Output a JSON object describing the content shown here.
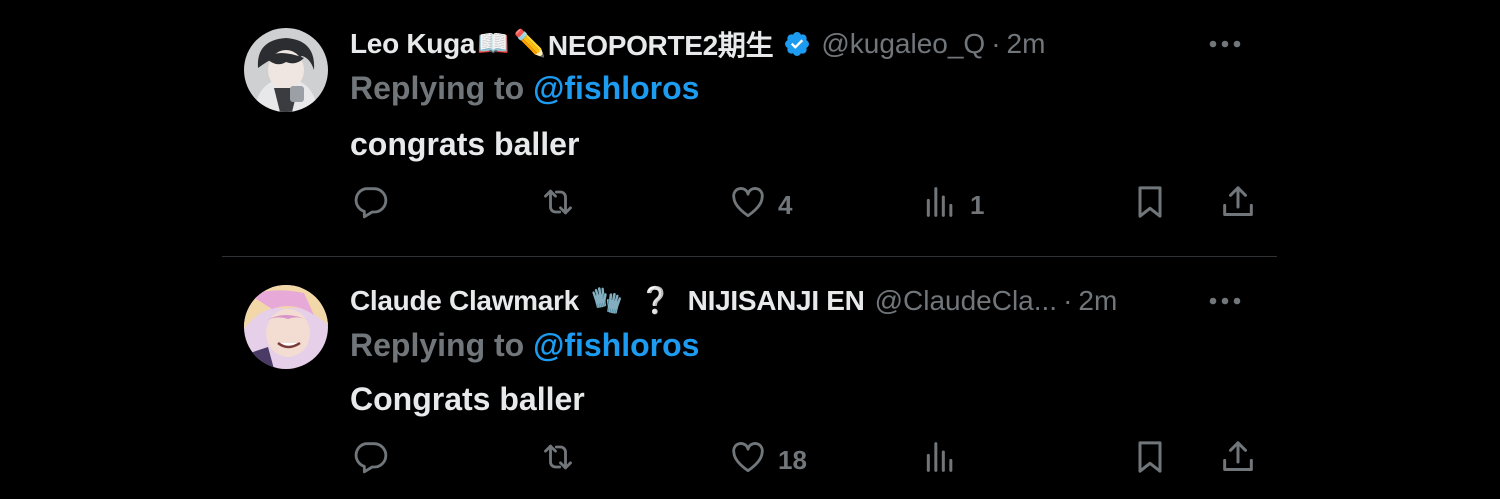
{
  "posts": [
    {
      "name_main": "Leo Kuga",
      "name_emoji_1": "📖",
      "name_emoji_2": "✏️",
      "name_suffix": "NEOPORTE2期生",
      "handle": "@kugaleo_Q",
      "dot": "·",
      "time": "2m",
      "replying_prefix": "Replying to",
      "replying_handle": "@fishloros",
      "text": "congrats baller",
      "likes": "4",
      "views": "1",
      "verified": true
    },
    {
      "name_main": "Claude Clawmark",
      "name_emoji_1": "🧤",
      "name_emoji_2": "❔",
      "name_suffix": "NIJISANJI EN",
      "handle": "@ClaudeCla...",
      "dot": "·",
      "time": "2m",
      "replying_prefix": "Replying to",
      "replying_handle": "@fishloros",
      "text": "Congrats baller",
      "likes": "18",
      "views": ""
    }
  ],
  "colors": {
    "background": "#000000",
    "text": "#e7e9ea",
    "muted": "#71767b",
    "accent": "#1d9bf0"
  },
  "icons": [
    "reply-icon",
    "repost-icon",
    "like-icon",
    "views-icon",
    "bookmark-icon",
    "share-icon",
    "more-icon",
    "verified-icon"
  ]
}
